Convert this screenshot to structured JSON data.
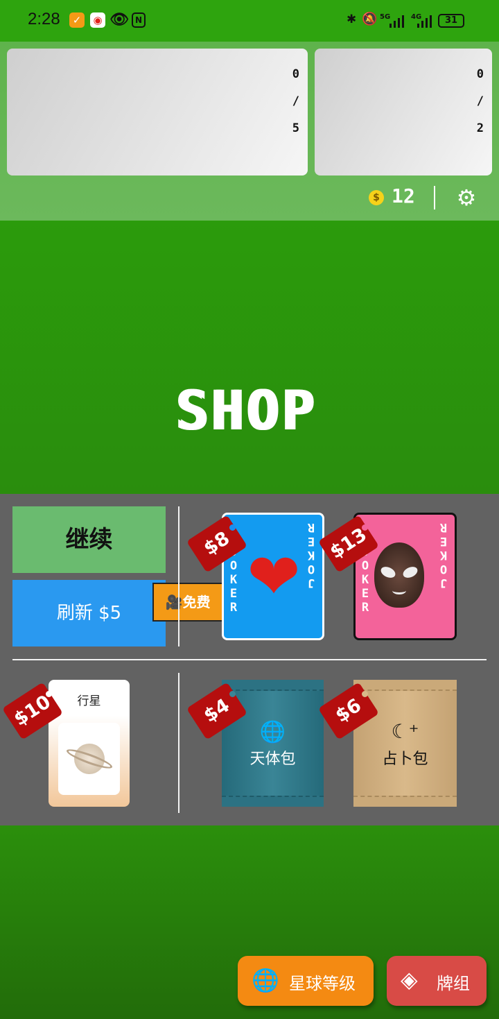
{
  "status_bar": {
    "time": "2:28",
    "battery": "31",
    "net1": "5G",
    "net2": "4G"
  },
  "joker_slot": {
    "count": "0",
    "sep": "/",
    "max": "5"
  },
  "consumable_slot": {
    "count": "0",
    "sep": "/",
    "max": "2"
  },
  "money": "12",
  "coin_symbol": "$",
  "title": "SHOP",
  "actions": {
    "continue_label": "继续",
    "refresh_label": "刷新 $5",
    "free_label": "免费"
  },
  "shop_items": [
    {
      "price": "$8",
      "kind": "joker",
      "art": "heart",
      "joker_text": "JOKER"
    },
    {
      "price": "$13",
      "kind": "joker",
      "art": "alien",
      "joker_text": "JOKER"
    },
    {
      "price": "$10",
      "kind": "planet",
      "title": "行星"
    },
    {
      "price": "$4",
      "kind": "pack",
      "label": "天体包"
    },
    {
      "price": "$6",
      "kind": "pack",
      "label": "占卜包"
    }
  ],
  "bottom": {
    "planet_levels_label": "星球等级",
    "deck_label": "牌组"
  },
  "colors": {
    "green": "#2a9a0c",
    "refresh_blue": "#2a99f0",
    "price_red": "#b50e0e",
    "orange": "#f48a12",
    "deck_red": "#d84b46"
  }
}
